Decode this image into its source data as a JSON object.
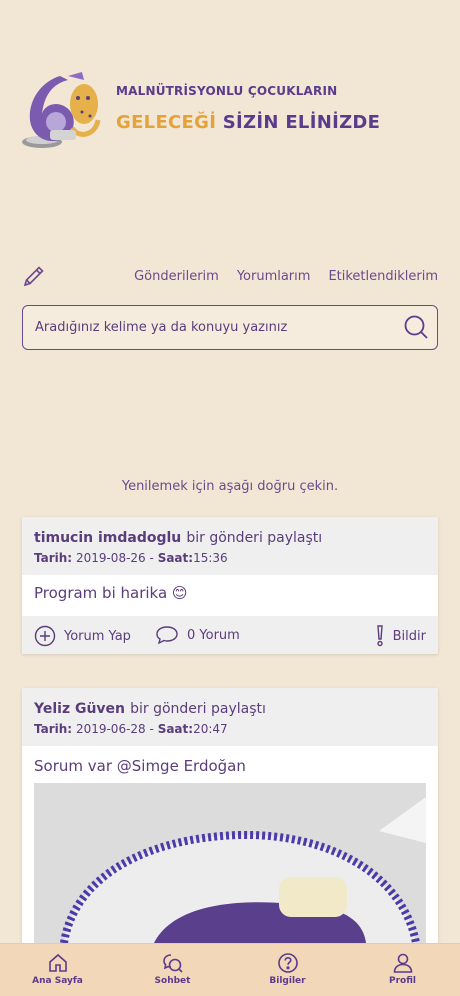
{
  "header": {
    "slogan_line1": "MALNÜTRİSYONLU ÇOCUKLARIN",
    "slogan_line2_gold": "GELECEĞİ",
    "slogan_line2_purple": "SİZİN ELİNİZDE"
  },
  "tabs": {
    "items": [
      {
        "label": "Gönderilerim"
      },
      {
        "label": "Yorumlarım"
      },
      {
        "label": "Etiketlendiklerim"
      }
    ]
  },
  "search": {
    "placeholder": "Aradığınız kelime ya da konuyu yazınız"
  },
  "pull_hint": "Yenilemek için aşağı doğru çekin.",
  "posts": [
    {
      "author": "timucin imdadoglu",
      "action": "bir gönderi paylaştı",
      "date_label": "Tarih:",
      "date": "2019-08-26",
      "time_label": "Saat:",
      "time": "15:36",
      "separator": "-",
      "text": "Program bi harika 😊",
      "comment_label": "Yorum Yap",
      "comment_count_label": "0 Yorum",
      "report_label": "Bildir"
    },
    {
      "author": "Yeliz Güven",
      "action": "bir gönderi paylaştı",
      "date_label": "Tarih:",
      "date": "2019-06-28",
      "time_label": "Saat:",
      "time": "20:47",
      "separator": "-",
      "text": "Sorum var @Simge Erdoğan"
    }
  ],
  "bottom_nav": {
    "items": [
      {
        "label": "Ana Sayfa",
        "icon": "home-icon"
      },
      {
        "label": "Sohbet",
        "icon": "chat-icon"
      },
      {
        "label": "Bilgiler",
        "icon": "help-icon"
      },
      {
        "label": "Profil",
        "icon": "profile-icon"
      }
    ]
  },
  "colors": {
    "background": "#f2e6d4",
    "primary": "#5b3b8c",
    "accent": "#e6a23a",
    "nav_bg": "#f2d7b8"
  }
}
